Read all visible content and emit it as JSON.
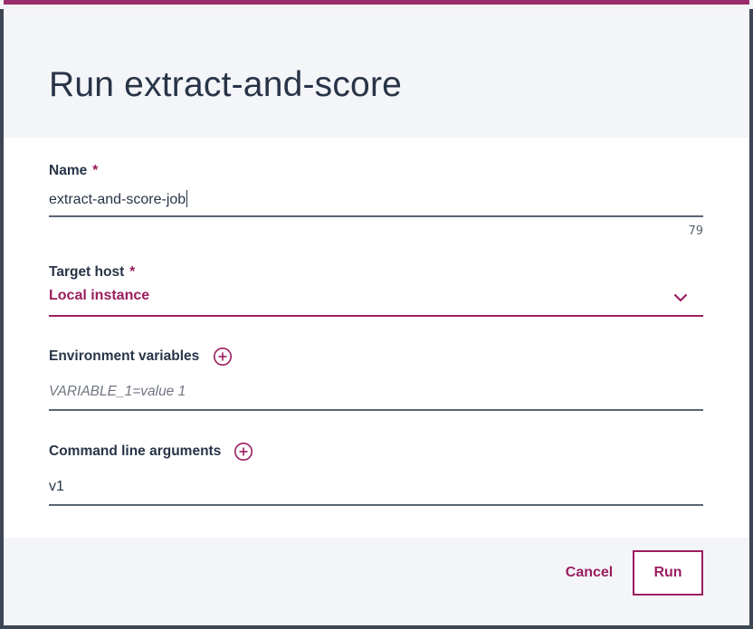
{
  "dialog": {
    "title": "Run extract-and-score"
  },
  "name_field": {
    "label": "Name",
    "required_marker": "*",
    "value": "extract-and-score-job",
    "char_counter": "79"
  },
  "target_host": {
    "label": "Target host",
    "required_marker": "*",
    "selected": "Local instance",
    "icon": "chevron-down-icon"
  },
  "env_vars": {
    "label": "Environment variables",
    "placeholder": "VARIABLE_1=value 1",
    "add_icon": "plus-circle-icon"
  },
  "cmd_args": {
    "label": "Command line arguments",
    "value": "v1",
    "add_icon": "plus-circle-icon"
  },
  "actions": {
    "cancel_label": "Cancel",
    "run_label": "Run"
  },
  "colors": {
    "accent": "#9b1d5f",
    "text": "#283447",
    "header_bg": "#f4f5f8"
  }
}
